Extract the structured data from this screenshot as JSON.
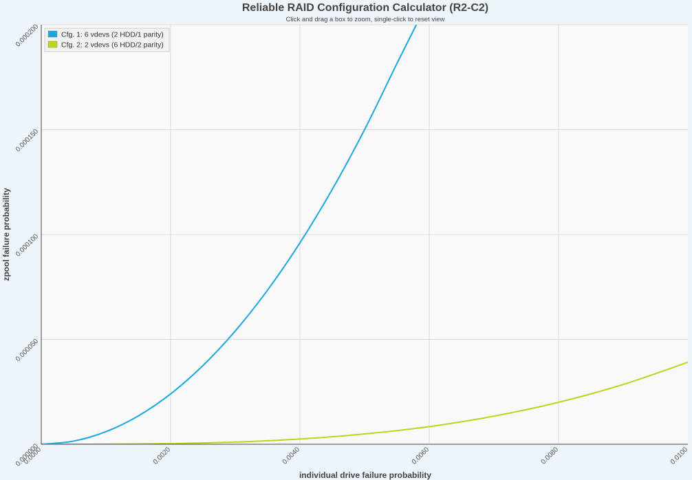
{
  "chart_data": {
    "type": "line",
    "title": "Reliable RAID Configuration Calculator (R2-C2)",
    "subtitle": "Click and drag a box to zoom, single-click to reset view",
    "xlabel": "individual drive failure probability",
    "ylabel": "zpool failure probability",
    "xlim": [
      0,
      0.01
    ],
    "ylim": [
      0,
      0.0002
    ],
    "x_ticks": [
      "0.0000",
      "0.0020",
      "0.0040",
      "0.0060",
      "0.0080",
      "0.0100"
    ],
    "y_ticks": [
      "0.000000",
      "0.000050",
      "0.000100",
      "0.000150",
      "0.000200"
    ],
    "grid": true,
    "legend_position": "top-left",
    "series": [
      {
        "name": "Cfg. 1: 6 vdevs (2 HDD/1 parity)",
        "color": "#1aa7e0",
        "x": [
          0,
          0.0005,
          0.001,
          0.0015,
          0.002,
          0.0025,
          0.003,
          0.0035,
          0.004,
          0.0045,
          0.005,
          0.0055,
          0.0058
        ],
        "y": [
          0,
          1.5e-06,
          6e-06,
          1.35e-05,
          2.4e-05,
          3.75e-05,
          5.4e-05,
          7.35e-05,
          9.6e-05,
          0.0001215,
          0.00015,
          0.0001815,
          0.0002
        ]
      },
      {
        "name": "Cfg. 2: 2 vdevs (6 HDD/2 parity)",
        "color": "#bfd31a",
        "x": [
          0,
          0.001,
          0.002,
          0.003,
          0.004,
          0.005,
          0.006,
          0.007,
          0.008,
          0.009,
          0.01
        ],
        "y": [
          0,
          4e-08,
          3e-07,
          1.05e-06,
          2.5e-06,
          4.9e-06,
          8.4e-06,
          1.34e-05,
          2e-05,
          2.85e-05,
          3.91e-05
        ]
      }
    ]
  }
}
